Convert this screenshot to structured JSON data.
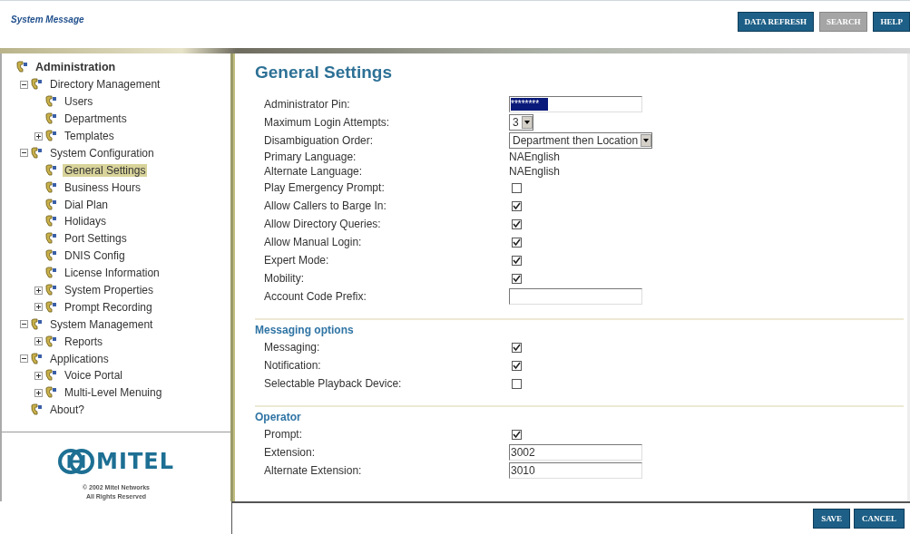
{
  "header": {
    "title": "System Message",
    "buttons": [
      {
        "label": "DATA REFRESH",
        "disabled": false
      },
      {
        "label": "SEARCH",
        "disabled": true
      },
      {
        "label": "HELP",
        "disabled": false
      }
    ]
  },
  "sidebar": {
    "tree": [
      {
        "label": "Administration",
        "bold": true,
        "selected": false,
        "children": [
          {
            "label": "Directory Management",
            "expanded": true,
            "selected": false,
            "children": [
              {
                "label": "Users",
                "selected": false
              },
              {
                "label": "Departments",
                "selected": false
              },
              {
                "label": "Templates",
                "expanded": false,
                "selected": false
              }
            ]
          },
          {
            "label": "System Configuration",
            "expanded": true,
            "selected": false,
            "children": [
              {
                "label": "General Settings",
                "selected": true
              },
              {
                "label": "Business Hours",
                "selected": false
              },
              {
                "label": "Dial Plan",
                "selected": false
              },
              {
                "label": "Holidays",
                "selected": false
              },
              {
                "label": "Port Settings",
                "selected": false
              },
              {
                "label": "DNIS Config",
                "selected": false
              },
              {
                "label": "License Information",
                "selected": false
              },
              {
                "label": "System Properties",
                "expanded": false,
                "selected": false
              },
              {
                "label": "Prompt Recording",
                "expanded": false,
                "selected": false
              }
            ]
          },
          {
            "label": "System Management",
            "expanded": true,
            "selected": false,
            "children": [
              {
                "label": "Reports",
                "expanded": false,
                "selected": false
              }
            ]
          },
          {
            "label": "Applications",
            "expanded": true,
            "selected": false,
            "children": [
              {
                "label": "Voice Portal",
                "expanded": false,
                "selected": false
              },
              {
                "label": "Multi-Level Menuing",
                "expanded": false,
                "selected": false
              }
            ]
          },
          {
            "label": "About?",
            "selected": false
          }
        ]
      }
    ],
    "logo": "MITEL",
    "copyright": [
      "© 2002 Mitel Networks",
      "All Rights Reserved"
    ]
  },
  "page": {
    "title": "General Settings",
    "sections": [
      {
        "rows": [
          {
            "kind": "password",
            "label": "Administrator Pin:",
            "value": "********"
          },
          {
            "kind": "select",
            "label": "Maximum Login Attempts:",
            "value": "3"
          },
          {
            "kind": "select",
            "label": "Disambiguation Order:",
            "value": "Department then Location"
          },
          {
            "kind": "text",
            "label": "Primary Language:",
            "value": "NAEnglish"
          },
          {
            "kind": "text",
            "label": "Alternate Language:",
            "value": "NAEnglish"
          },
          {
            "kind": "checkbox",
            "label": "Play Emergency Prompt:",
            "checked": false
          },
          {
            "kind": "checkbox",
            "label": "Allow Callers to Barge In:",
            "checked": true
          },
          {
            "kind": "checkbox",
            "label": "Allow Directory Queries:",
            "checked": true
          },
          {
            "kind": "checkbox",
            "label": "Allow Manual Login:",
            "checked": true
          },
          {
            "kind": "checkbox",
            "label": "Expert Mode:",
            "checked": true
          },
          {
            "kind": "checkbox",
            "label": "Mobility:",
            "checked": true
          },
          {
            "kind": "input",
            "label": "Account Code Prefix:",
            "value": ""
          }
        ]
      },
      {
        "title": "Messaging options",
        "rows": [
          {
            "kind": "checkbox",
            "label": "Messaging:",
            "checked": true
          },
          {
            "kind": "checkbox",
            "label": "Notification:",
            "checked": true
          },
          {
            "kind": "checkbox",
            "label": "Selectable Playback Device:",
            "checked": false
          }
        ]
      },
      {
        "title": "Operator",
        "rows": [
          {
            "kind": "checkbox",
            "label": "Prompt:",
            "checked": true
          },
          {
            "kind": "input",
            "label": "Extension:",
            "value": "3002"
          },
          {
            "kind": "input",
            "label": "Alternate Extension:",
            "value": "3010"
          }
        ]
      }
    ]
  },
  "footer": {
    "buttons": [
      "SAVE",
      "CANCEL"
    ]
  }
}
